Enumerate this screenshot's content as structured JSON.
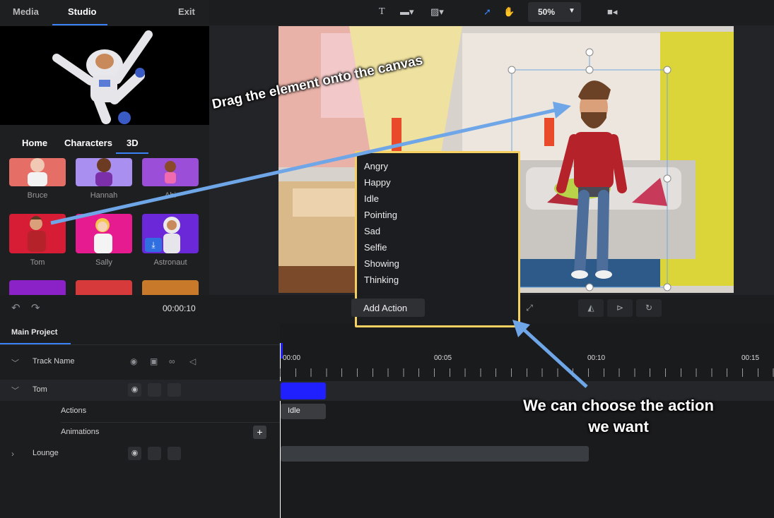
{
  "top_tabs": {
    "media": "Media",
    "studio": "Studio",
    "exit": "Exit"
  },
  "library_tabs": {
    "home": "Home",
    "characters": "Characters",
    "threed": "3D"
  },
  "characters": [
    {
      "name": "Bruce"
    },
    {
      "name": "Hannah"
    },
    {
      "name": "Abi"
    },
    {
      "name": "Tom"
    },
    {
      "name": "Sally"
    },
    {
      "name": "Astronaut"
    }
  ],
  "toolbar": {
    "zoom": "50%"
  },
  "dropdown": {
    "items": [
      "Angry",
      "Happy",
      "Idle",
      "Pointing",
      "Sad",
      "Selfie",
      "Showing",
      "Thinking"
    ]
  },
  "controls": {
    "add_action": "Add Action",
    "time": "00:00:10"
  },
  "timeline": {
    "tab": "Main Project",
    "track_name_header": "Track Name",
    "tracks": {
      "tom": "Tom",
      "actions": "Actions",
      "animations": "Animations",
      "lounge": "Lounge"
    },
    "ticks": [
      "00:00",
      "00:05",
      "00:10",
      "00:15"
    ],
    "idle_clip": "Idle"
  },
  "annotations": {
    "drag": "Drag the element onto the canvas",
    "choose": "We can choose the action we want"
  },
  "colors": {
    "accent": "#3b82f6",
    "highlight": "#f5cf5f",
    "clip_blue": "#2020ff",
    "arrow": "#6ea6e8"
  }
}
